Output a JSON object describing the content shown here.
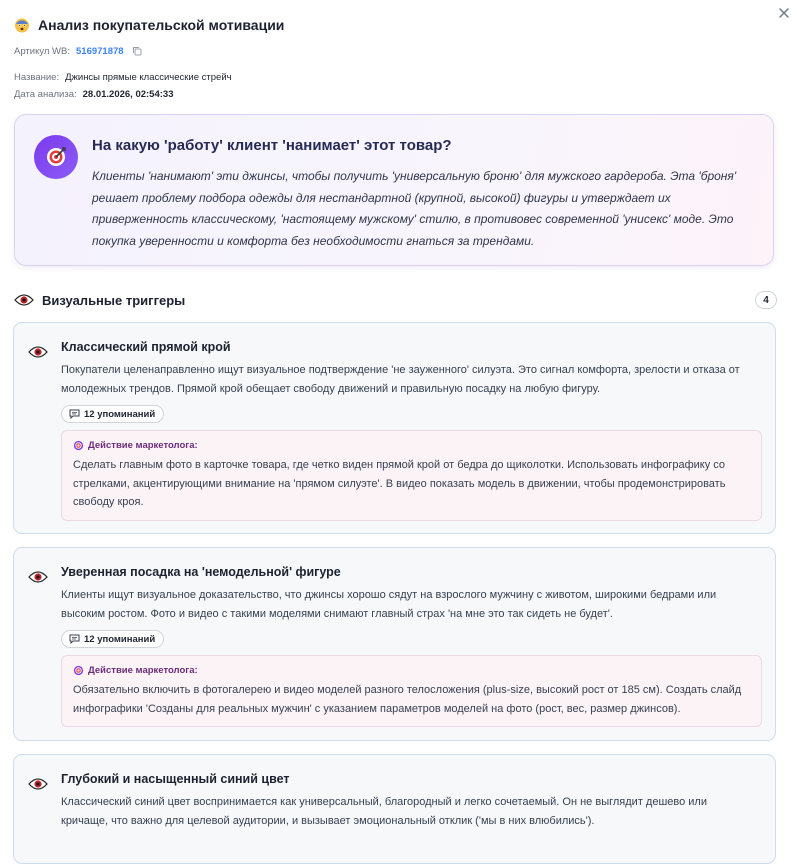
{
  "header": {
    "title": "Анализ покупательской мотивации",
    "article_label": "Артикул WB:",
    "article_value": "516971878",
    "name_label": "Название:",
    "name_value": "Джинсы прямые классические стрейч",
    "date_label": "Дата анализа:",
    "date_value": "28.01.2026, 02:54:33"
  },
  "jtbd": {
    "question": "На какую 'работу' клиент 'нанимает' этот товар?",
    "answer": "Клиенты 'нанимают' эти джинсы, чтобы получить 'универсальную броню' для мужского гардероба. Эта 'броня' решает проблему подбора одежды для нестандартной (крупной, высокой) фигуры и утверждает их приверженность классическому, 'настоящему мужскому' стилю, в противовес современной 'унисекс' моде. Это покупка уверенности и комфорта без необходимости гнаться за трендами."
  },
  "section": {
    "title": "Визуальные триггеры",
    "count": "4"
  },
  "action_label": "Действие маркетолога:",
  "triggers": [
    {
      "title": "Классический прямой крой",
      "description": "Покупатели целенаправленно ищут визуальное подтверждение 'не зауженного' силуэта. Это сигнал комфорта, зрелости и отказа от молодежных трендов. Прямой крой обещает свободу движений и правильную посадку на любую фигуру.",
      "mentions": "12 упоминаний",
      "action": "Сделать главным фото в карточке товара, где четко виден прямой крой от бедра до щиколотки. Использовать инфографику со стрелками, акцентирующими внимание на 'прямом силуэте'. В видео показать модель в движении, чтобы продемонстрировать свободу кроя."
    },
    {
      "title": "Уверенная посадка на 'немодельной' фигуре",
      "description": "Клиенты ищут визуальное доказательство, что джинсы хорошо сядут на взрослого мужчину с животом, широкими бедрами или высоким ростом. Фото и видео с такими моделями снимают главный страх 'на мне это так сидеть не будет'.",
      "mentions": "12 упоминаний",
      "action": "Обязательно включить в фотогалерею и видео моделей разного телосложения (plus-size, высокий рост от 185 см). Создать слайд инфографики 'Созданы для реальных мужчин' с указанием параметров моделей на фото (рост, вес, размер джинсов)."
    },
    {
      "title": "Глубокий и насыщенный синий цвет",
      "description": "Классический синий цвет воспринимается как универсальный, благородный и легко сочетаемый. Он не выглядит дешево или кричаще, что важно для целевой аудитории, и вызывает эмоциональный отклик ('мы в них влюбились')."
    }
  ],
  "icons": {
    "close": "close-icon",
    "emoji": "shocked-face-icon",
    "target": "target-icon",
    "eye": "eye-icon",
    "chat": "chat-bubble-icon",
    "copy": "copy-icon"
  },
  "colors": {
    "accent": "#7c3aed",
    "link": "#3b82f6",
    "eye_red": "#c0242b"
  }
}
